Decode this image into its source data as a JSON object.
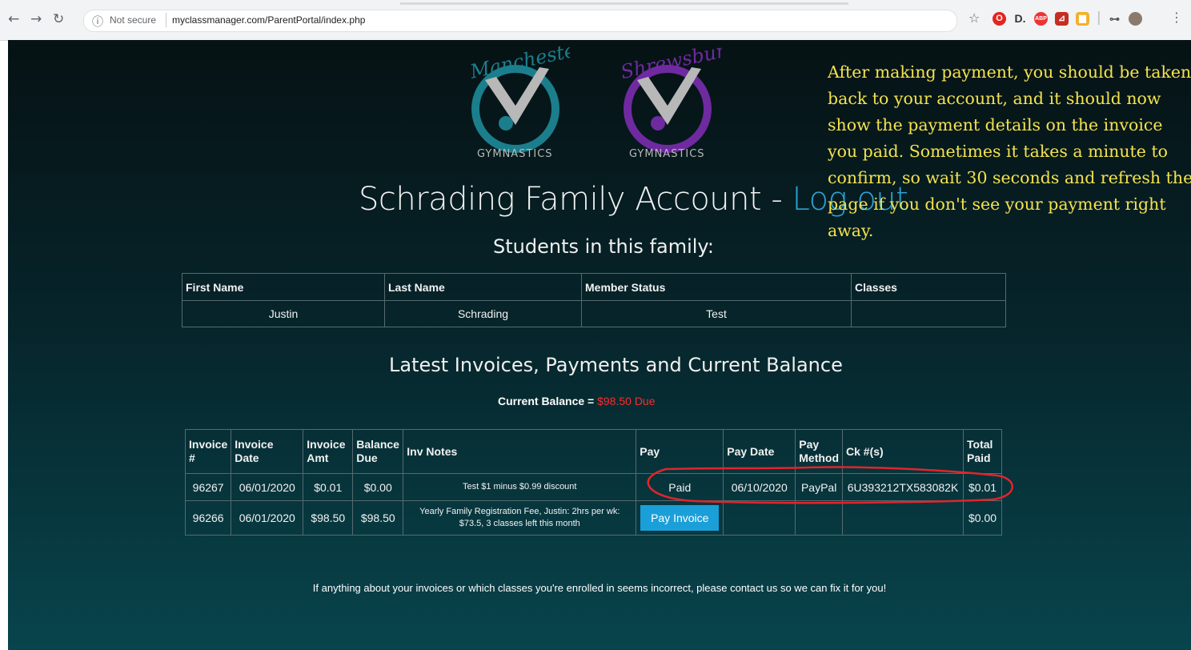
{
  "browser": {
    "security_label": "Not secure",
    "url": "myclassmanager.com/ParentPortal/index.php"
  },
  "logos": [
    {
      "script": "Manchester",
      "word": "GYMNASTICS",
      "color": "#1b7e8c"
    },
    {
      "script": "Shrewsbury",
      "word": "GYMNASTICS",
      "color": "#6f2aa0"
    }
  ],
  "header": {
    "title": "Schrading Family Account - ",
    "logout_label": "Log out"
  },
  "annotation": "After making payment, you should be taken back to your account, and it should now show the payment details on the invoice you paid.  Sometimes it takes a minute to confirm, so wait 30 seconds and refresh the page if you don't see your payment right away.",
  "students": {
    "title": "Students in this family:",
    "columns": [
      "First Name",
      "Last Name",
      "Member Status",
      "Classes"
    ],
    "rows": [
      [
        "Justin",
        "Schrading",
        "Test",
        ""
      ]
    ]
  },
  "invoices": {
    "title": "Latest Invoices, Payments and Current Balance",
    "balance_label": "Current Balance = ",
    "balance_value": "$98.50 Due",
    "columns": [
      "Invoice #",
      "Invoice Date",
      "Invoice Amt",
      "Balance Due",
      "Inv Notes",
      "Pay",
      "Pay Date",
      "Pay Method",
      "Ck #(s)",
      "Total Paid"
    ],
    "rows": [
      {
        "number": "96267",
        "date": "06/01/2020",
        "amount": "$0.01",
        "balance": "$0.00",
        "notes": "Test $1 minus $0.99 discount",
        "pay": "Paid",
        "pay_date": "06/10/2020",
        "method": "PayPal",
        "check": "6U393212TX583082K",
        "total_paid": "$0.01"
      },
      {
        "number": "96266",
        "date": "06/01/2020",
        "amount": "$98.50",
        "balance": "$98.50",
        "notes": "Yearly Family Registration Fee, Justin: 2hrs per wk: $73.5, 3 classes left this month",
        "pay_button": "Pay Invoice",
        "pay_date": "",
        "method": "",
        "check": "",
        "total_paid": "$0.00"
      }
    ]
  },
  "footer": "If anything about your invoices or which classes you're enrolled in seems incorrect, please contact us so we can fix it for you!",
  "colors": {
    "accent": "#2aa3d6",
    "annotation": "#f3e24e",
    "due": "#ff2a2a",
    "highlight": "#e3242b"
  }
}
